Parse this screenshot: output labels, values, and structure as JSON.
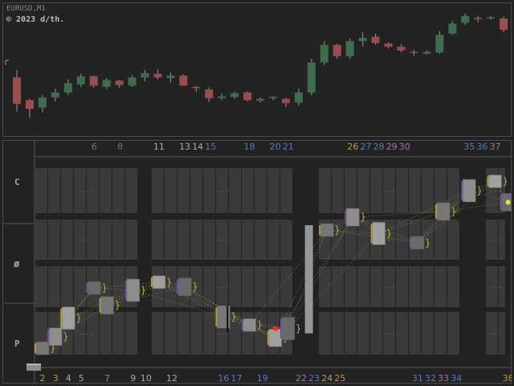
{
  "chart": {
    "symbol": "EURUSD,M1",
    "copyright": "© 2023 d/th."
  },
  "colors": {
    "background": "#222222",
    "bull": "#3d6e4c",
    "bear": "#9b4c4c",
    "wick": "#9a9a9a",
    "grid_cell": "#3a3a3a",
    "panel_line": "#555555",
    "label_gray": "#aaaaaa"
  },
  "candles": [
    {
      "o": 1.08428,
      "h": 1.0844,
      "l": 1.08374,
      "c": 1.08386
    },
    {
      "o": 1.08392,
      "h": 1.08394,
      "l": 1.08364,
      "c": 1.08378
    },
    {
      "o": 1.0838,
      "h": 1.084,
      "l": 1.08372,
      "c": 1.08396
    },
    {
      "o": 1.08396,
      "h": 1.0841,
      "l": 1.0839,
      "c": 1.08404
    },
    {
      "o": 1.08404,
      "h": 1.08425,
      "l": 1.084,
      "c": 1.08419
    },
    {
      "o": 1.08417,
      "h": 1.08434,
      "l": 1.08413,
      "c": 1.0843
    },
    {
      "o": 1.0843,
      "h": 1.08431,
      "l": 1.08412,
      "c": 1.08415
    },
    {
      "o": 1.08413,
      "h": 1.08427,
      "l": 1.0841,
      "c": 1.08424
    },
    {
      "o": 1.08423,
      "h": 1.08424,
      "l": 1.08412,
      "c": 1.08416
    },
    {
      "o": 1.08415,
      "h": 1.08432,
      "l": 1.08413,
      "c": 1.08428
    },
    {
      "o": 1.08428,
      "h": 1.0844,
      "l": 1.08422,
      "c": 1.08435
    },
    {
      "o": 1.08434,
      "h": 1.08441,
      "l": 1.08425,
      "c": 1.08428
    },
    {
      "o": 1.08427,
      "h": 1.08436,
      "l": 1.0842,
      "c": 1.08431
    },
    {
      "o": 1.08431,
      "h": 1.08433,
      "l": 1.08415,
      "c": 1.08415
    },
    {
      "o": 1.08413,
      "h": 1.08415,
      "l": 1.08405,
      "c": 1.08411
    },
    {
      "o": 1.08409,
      "h": 1.08412,
      "l": 1.08389,
      "c": 1.08395
    },
    {
      "o": 1.08395,
      "h": 1.08402,
      "l": 1.08392,
      "c": 1.08398
    },
    {
      "o": 1.08397,
      "h": 1.08405,
      "l": 1.08394,
      "c": 1.08403
    },
    {
      "o": 1.08404,
      "h": 1.08406,
      "l": 1.0839,
      "c": 1.08392
    },
    {
      "o": 1.08391,
      "h": 1.08396,
      "l": 1.08388,
      "c": 1.08394
    },
    {
      "o": 1.08395,
      "h": 1.08398,
      "l": 1.08392,
      "c": 1.08397
    },
    {
      "o": 1.08394,
      "h": 1.08396,
      "l": 1.08381,
      "c": 1.08387
    },
    {
      "o": 1.08388,
      "h": 1.0841,
      "l": 1.08383,
      "c": 1.08404
    },
    {
      "o": 1.08404,
      "h": 1.08458,
      "l": 1.084,
      "c": 1.08452
    },
    {
      "o": 1.08452,
      "h": 1.08486,
      "l": 1.08448,
      "c": 1.0848
    },
    {
      "o": 1.0848,
      "h": 1.08482,
      "l": 1.08458,
      "c": 1.08462
    },
    {
      "o": 1.08462,
      "h": 1.0849,
      "l": 1.08458,
      "c": 1.08486
    },
    {
      "o": 1.08486,
      "h": 1.085,
      "l": 1.08478,
      "c": 1.08491
    },
    {
      "o": 1.08493,
      "h": 1.08498,
      "l": 1.0848,
      "c": 1.08483
    },
    {
      "o": 1.08482,
      "h": 1.08484,
      "l": 1.08474,
      "c": 1.08477
    },
    {
      "o": 1.08477,
      "h": 1.08481,
      "l": 1.08468,
      "c": 1.08471
    },
    {
      "o": 1.08469,
      "h": 1.08472,
      "l": 1.08463,
      "c": 1.08467
    },
    {
      "o": 1.08466,
      "h": 1.08471,
      "l": 1.08464,
      "c": 1.08469
    },
    {
      "o": 1.08468,
      "h": 1.08502,
      "l": 1.08466,
      "c": 1.08496
    },
    {
      "o": 1.08498,
      "h": 1.08518,
      "l": 1.08496,
      "c": 1.08514
    },
    {
      "o": 1.08515,
      "h": 1.0853,
      "l": 1.08512,
      "c": 1.08526
    },
    {
      "o": 1.08523,
      "h": 1.08526,
      "l": 1.08516,
      "c": 1.08522
    },
    {
      "o": 1.08522,
      "h": 1.08526,
      "l": 1.0852,
      "c": 1.08524
    },
    {
      "o": 1.08522,
      "h": 1.08525,
      "l": 1.085,
      "c": 1.08504
    },
    {
      "o": 1.08503,
      "h": 1.08506,
      "l": 1.08501,
      "c": 1.08504
    }
  ],
  "row_labels": [
    "C",
    "ø",
    "P"
  ],
  "top_numbers": [
    {
      "t": "6",
      "c": "#4d7fc0"
    },
    {
      "t": "8",
      "c": "#4d7fc0"
    },
    {
      "t": "11",
      "c": "#aaaaaa"
    },
    {
      "t": "13",
      "c": "#aaaaaa"
    },
    {
      "t": "14",
      "c": "#aaaaaa"
    },
    {
      "t": "15",
      "c": "#4d7fc0"
    },
    {
      "t": "18",
      "c": "#4d7fc0"
    },
    {
      "t": "20",
      "c": "#4d7fc0"
    },
    {
      "t": "21",
      "c": "#4d7fc0"
    },
    {
      "t": "26",
      "c": "#b89a3c"
    },
    {
      "t": "27",
      "c": "#4d7fc0"
    },
    {
      "t": "28",
      "c": "#4d7fc0"
    },
    {
      "t": "29",
      "c": "#b06ab0"
    },
    {
      "t": "30",
      "c": "#b06ab0"
    },
    {
      "t": "35",
      "c": "#4d7fc0"
    },
    {
      "t": "36",
      "c": "#4d7fc0"
    },
    {
      "t": "37",
      "c": "#b06ab0"
    }
  ],
  "bottom_numbers": [
    {
      "t": "2",
      "c": "#b89a3c"
    },
    {
      "t": "3",
      "c": "#b89a3c"
    },
    {
      "t": "4",
      "c": "#aaaaaa"
    },
    {
      "t": "5",
      "c": "#aaaaaa"
    },
    {
      "t": "7",
      "c": "#b06ab0"
    },
    {
      "t": "9",
      "c": "#aaaaaa"
    },
    {
      "t": "10",
      "c": "#aaaaaa"
    },
    {
      "t": "12",
      "c": "#aaaaaa"
    },
    {
      "t": "16",
      "c": "#4d7fc0"
    },
    {
      "t": "17",
      "c": "#4d7fc0"
    },
    {
      "t": "19",
      "c": "#4d7fc0"
    },
    {
      "t": "22",
      "c": "#b06ab0"
    },
    {
      "t": "23",
      "c": "#4d7fc0"
    },
    {
      "t": "24",
      "c": "#b89a3c"
    },
    {
      "t": "25",
      "c": "#b89a3c"
    },
    {
      "t": "31",
      "c": "#4d7fc0"
    },
    {
      "t": "32",
      "c": "#4d7fc0"
    },
    {
      "t": "33",
      "c": "#b06ab0"
    },
    {
      "t": "34",
      "c": "#4d7fc0"
    },
    {
      "t": "38",
      "c": "#b89a3c"
    }
  ],
  "path_points": [
    [
      1.08378,
      2
    ],
    [
      1.08388,
      3
    ],
    [
      1.08404,
      4
    ],
    [
      1.0843,
      6
    ],
    [
      1.08415,
      7
    ],
    [
      1.08428,
      9
    ],
    [
      1.08435,
      11
    ],
    [
      1.08431,
      13
    ],
    [
      1.08405,
      16
    ],
    [
      1.08398,
      18
    ],
    [
      1.08387,
      20
    ],
    [
      1.08395,
      21
    ],
    [
      1.0848,
      24
    ],
    [
      1.08491,
      26
    ],
    [
      1.08477,
      28
    ],
    [
      1.08469,
      31
    ],
    [
      1.08496,
      33
    ],
    [
      1.08514,
      35
    ],
    [
      1.08522,
      37
    ],
    [
      1.08504,
      38
    ]
  ],
  "markers": {
    "red_index": 20,
    "yellow_index": 19
  }
}
